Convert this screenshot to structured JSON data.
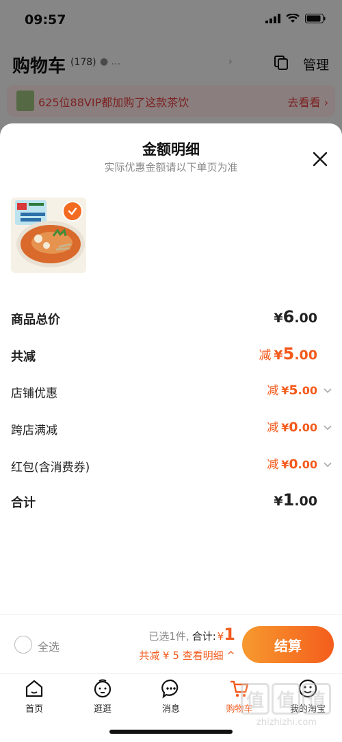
{
  "status_bar": {
    "time": "09:57"
  },
  "cart_header": {
    "title": "购物车",
    "count": "(178)",
    "location": "...",
    "manage_label": "管理"
  },
  "vip_banner": {
    "text": "625位88VIP都加购了这款茶饮",
    "link": "去看看 ›"
  },
  "sheet": {
    "title": "金额明细",
    "subtitle": "实际优惠金额请以下单页为准",
    "rows": [
      {
        "label": "商品总价",
        "prefix": "",
        "yen": "¥",
        "int": "6",
        "dec": ".00"
      },
      {
        "label": "共减",
        "prefix": "减",
        "yen": "¥",
        "int": "5",
        "dec": ".00"
      },
      {
        "label": "店铺优惠",
        "prefix": "减",
        "yen": "¥",
        "int": "5",
        "dec": ".00"
      },
      {
        "label": "跨店满减",
        "prefix": "减",
        "yen": "¥",
        "int": "0",
        "dec": ".00"
      },
      {
        "label": "红包(含消费券)",
        "prefix": "减",
        "yen": "¥",
        "int": "0",
        "dec": ".00"
      },
      {
        "label": "合计",
        "prefix": "",
        "yen": "¥",
        "int": "1",
        "dec": ".00"
      }
    ]
  },
  "checkout": {
    "select_all": "全选",
    "selected_text": "已选1件,",
    "total_label": "合计:",
    "total_yen": "¥",
    "total_amount": "1",
    "discount_text": "共减 ¥ 5  查看明细 ^",
    "button": "结算"
  },
  "tabs": [
    {
      "label": "首页",
      "icon": "home-icon"
    },
    {
      "label": "逛逛",
      "icon": "browse-icon"
    },
    {
      "label": "消息",
      "icon": "message-icon"
    },
    {
      "label": "购物车",
      "icon": "cart-icon",
      "active": true
    },
    {
      "label": "我的淘宝",
      "icon": "profile-icon"
    }
  ],
  "watermark": {
    "chars": [
      "值",
      "值",
      "值"
    ],
    "domain": "zhizhizhi.com"
  },
  "colors": {
    "accent": "#f35a1c",
    "button_start": "#f79a2f",
    "button_end": "#f45d1c"
  }
}
